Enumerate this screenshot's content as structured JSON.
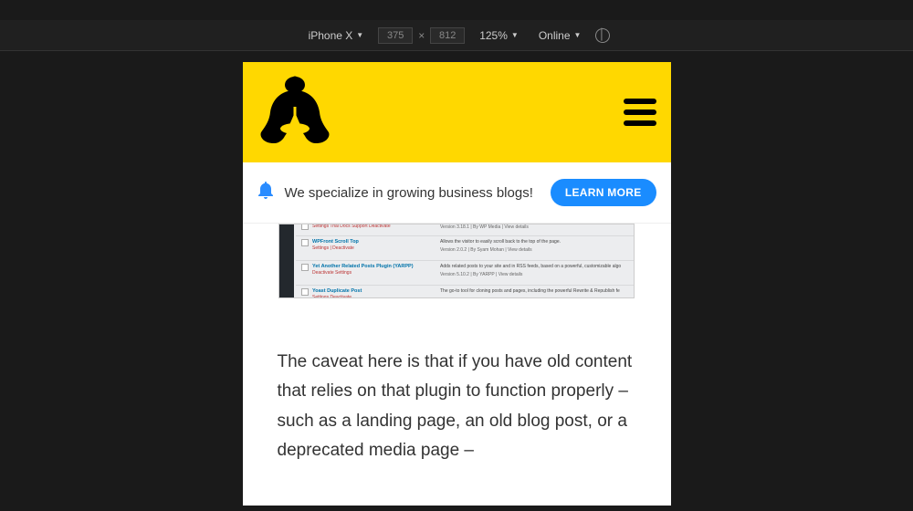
{
  "devtools": {
    "device": "iPhone X",
    "width": "375",
    "height": "812",
    "zoom": "125%",
    "throttle": "Online"
  },
  "site": {
    "notice_text": "We specialize in growing business blogs!",
    "cta_label": "LEARN MORE",
    "body_paragraph": "The caveat here is that if you have old content that relies on that plugin to function properly – such as a landing page, an old blog post, or a deprecated media page –"
  },
  "plugin_rows": [
    {
      "title": "",
      "meta": "Settings  Trial  Docs  Support  Deactivate",
      "desc": "",
      "ver": "Version 3.18.1 | By WP Media | View details"
    },
    {
      "title": "WPFront Scroll Top",
      "meta": "Settings | Deactivate",
      "desc": "Allows the visitor to easily scroll back to the top of the page.",
      "ver": "Version 2.0.2 | By Syam Mohan | View details"
    },
    {
      "title": "Yet Another Related Posts Plugin (YARPP)",
      "meta": "Deactivate  Settings",
      "desc": "Adds related posts to your site and in RSS feeds, based on a powerful, customizable algo",
      "ver": "Version 5.10.2 | By YARPP | View details"
    },
    {
      "title": "Yoast Duplicate Post",
      "meta": "Settings  Deactivate",
      "desc": "The go-to tool for cloning posts and pages, including the powerful Rewrite & Republish fe",
      "ver": ""
    }
  ]
}
